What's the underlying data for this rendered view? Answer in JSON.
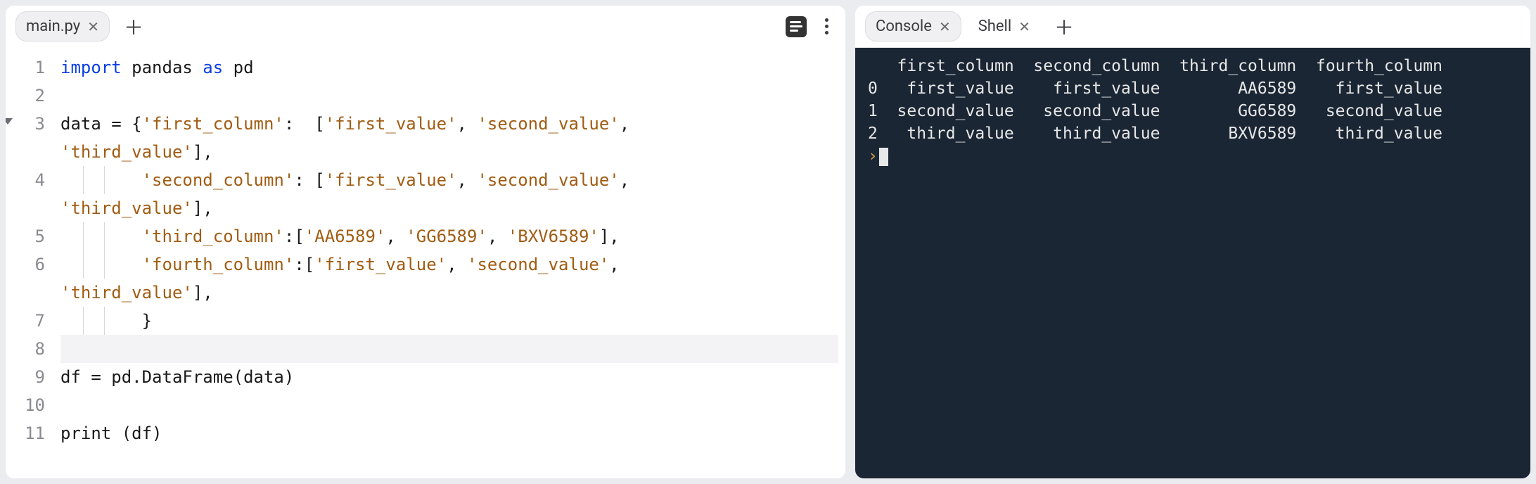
{
  "editor_panel": {
    "tabs": [
      {
        "label": "main.py",
        "active": true
      }
    ],
    "code": {
      "lines": [
        {
          "num": "1",
          "tokens": [
            {
              "t": "import",
              "c": "kw"
            },
            {
              "t": " pandas ",
              "c": "normal"
            },
            {
              "t": "as",
              "c": "kw"
            },
            {
              "t": " pd",
              "c": "normal"
            }
          ]
        },
        {
          "num": "2",
          "tokens": []
        },
        {
          "num": "3",
          "fold": true,
          "tokens": [
            {
              "t": "data = {",
              "c": "normal"
            },
            {
              "t": "'first_column'",
              "c": "str"
            },
            {
              "t": ":  [",
              "c": "normal"
            },
            {
              "t": "'first_value'",
              "c": "str"
            },
            {
              "t": ", ",
              "c": "normal"
            },
            {
              "t": "'second_value'",
              "c": "str"
            },
            {
              "t": ", ",
              "c": "normal"
            }
          ]
        },
        {
          "num": "",
          "tokens": [
            {
              "t": "'third_value'",
              "c": "str"
            },
            {
              "t": "],",
              "c": "normal"
            }
          ]
        },
        {
          "num": "4",
          "indent": 2,
          "tokens": [
            {
              "t": "        ",
              "c": "normal"
            },
            {
              "t": "'second_column'",
              "c": "str"
            },
            {
              "t": ": [",
              "c": "normal"
            },
            {
              "t": "'first_value'",
              "c": "str"
            },
            {
              "t": ", ",
              "c": "normal"
            },
            {
              "t": "'second_value'",
              "c": "str"
            },
            {
              "t": ", ",
              "c": "normal"
            }
          ]
        },
        {
          "num": "",
          "tokens": [
            {
              "t": "'third_value'",
              "c": "str"
            },
            {
              "t": "],",
              "c": "normal"
            }
          ]
        },
        {
          "num": "5",
          "indent": 2,
          "tokens": [
            {
              "t": "        ",
              "c": "normal"
            },
            {
              "t": "'third_column'",
              "c": "str"
            },
            {
              "t": ":[",
              "c": "normal"
            },
            {
              "t": "'AA6589'",
              "c": "str"
            },
            {
              "t": ", ",
              "c": "normal"
            },
            {
              "t": "'GG6589'",
              "c": "str"
            },
            {
              "t": ", ",
              "c": "normal"
            },
            {
              "t": "'BXV6589'",
              "c": "str"
            },
            {
              "t": "],",
              "c": "normal"
            }
          ]
        },
        {
          "num": "6",
          "indent": 2,
          "tokens": [
            {
              "t": "        ",
              "c": "normal"
            },
            {
              "t": "'fourth_column'",
              "c": "str"
            },
            {
              "t": ":[",
              "c": "normal"
            },
            {
              "t": "'first_value'",
              "c": "str"
            },
            {
              "t": ", ",
              "c": "normal"
            },
            {
              "t": "'second_value'",
              "c": "str"
            },
            {
              "t": ", ",
              "c": "normal"
            }
          ]
        },
        {
          "num": "",
          "tokens": [
            {
              "t": "'third_value'",
              "c": "str"
            },
            {
              "t": "],",
              "c": "normal"
            }
          ]
        },
        {
          "num": "7",
          "indent": 2,
          "tokens": [
            {
              "t": "        }",
              "c": "normal"
            }
          ]
        },
        {
          "num": "8",
          "current": true,
          "tokens": []
        },
        {
          "num": "9",
          "tokens": [
            {
              "t": "df = pd.DataFrame(data)",
              "c": "normal"
            }
          ]
        },
        {
          "num": "10",
          "tokens": []
        },
        {
          "num": "11",
          "tokens": [
            {
              "t": "print",
              "c": "normal"
            },
            {
              "t": " (df)",
              "c": "normal"
            }
          ]
        }
      ]
    }
  },
  "console_panel": {
    "tabs": [
      {
        "label": "Console",
        "active": true
      },
      {
        "label": "Shell",
        "active": false
      }
    ],
    "output": {
      "header": "   first_column  second_column  third_column  fourth_column",
      "rows": [
        "0   first_value    first_value        AA6589    first_value",
        "1  second_value   second_value        GG6589   second_value",
        "2   third_value    third_value       BXV6589    third_value"
      ],
      "prompt": "›"
    }
  }
}
